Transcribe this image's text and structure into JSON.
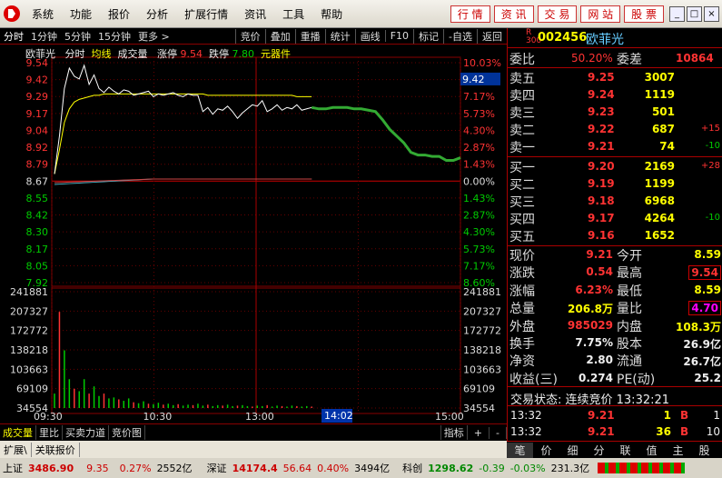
{
  "menu": {
    "items": [
      "系统",
      "功能",
      "报价",
      "分析",
      "扩展行情",
      "资讯",
      "工具",
      "帮助"
    ],
    "tools": [
      "行 情",
      "资 讯",
      "交 易",
      "网 站",
      "股 票"
    ],
    "win": [
      "_",
      "□",
      "×"
    ]
  },
  "tabs": {
    "items": [
      "分时",
      "1分钟",
      "5分钟",
      "15分钟",
      "更多 >"
    ],
    "buttons": [
      "竞价",
      "叠加",
      "重播",
      "统计",
      "画线",
      "F10",
      "标记",
      "-自选",
      "返回"
    ]
  },
  "chart_header": {
    "name": "欧菲光",
    "mode": "分时",
    "avg": "均线",
    "vol": "成交量",
    "zt_label": "涨停",
    "zt": "9.54",
    "dt_label": "跌停",
    "dt": "7.80",
    "sector": "元器件"
  },
  "chart_data": {
    "type": "line",
    "prev_close": 8.67,
    "price_ticks": [
      "9.54",
      "9.42",
      "9.29",
      "9.17",
      "9.04",
      "8.92",
      "8.79",
      "8.67",
      "8.55",
      "8.42",
      "8.30",
      "8.17",
      "8.05",
      "7.92"
    ],
    "pct_ticks": [
      "10.03%",
      "8.60%",
      "7.17%",
      "5.73%",
      "4.30%",
      "2.87%",
      "1.43%",
      "0.00%",
      "1.43%",
      "2.87%",
      "4.30%",
      "5.73%",
      "7.17%",
      "8.60%"
    ],
    "vol_ticks": [
      "241881",
      "207327",
      "172772",
      "138218",
      "103663",
      "69109",
      "34554"
    ],
    "time_ticks": [
      "09:30",
      "10:30",
      "13:00",
      "15:00"
    ],
    "cursor_time": "14:02",
    "cursor_price": "9.42",
    "price": [
      8.72,
      9.0,
      9.35,
      9.5,
      9.44,
      9.42,
      9.52,
      9.38,
      9.45,
      9.35,
      9.32,
      9.36,
      9.33,
      9.31,
      9.34,
      9.33,
      9.3,
      9.31,
      9.32,
      9.33,
      9.29,
      9.31,
      9.3,
      9.31,
      9.32,
      9.3,
      9.29,
      9.31,
      9.3,
      9.3,
      9.18,
      9.21,
      9.16,
      9.2,
      9.19,
      9.22,
      9.18,
      9.13,
      9.17,
      9.2,
      9.23,
      9.22,
      9.26,
      9.18,
      9.2,
      9.23,
      9.19,
      9.21,
      9.2,
      9.23,
      9.19,
      9.2,
      9.21
    ],
    "avg": [
      8.72,
      8.9,
      9.1,
      9.2,
      9.25,
      9.27,
      9.28,
      9.29,
      9.3,
      9.3,
      9.31,
      9.31,
      9.31,
      9.31,
      9.31,
      9.31,
      9.31,
      9.31,
      9.31,
      9.31,
      9.31,
      9.31,
      9.31,
      9.31,
      9.31,
      9.31,
      9.31,
      9.31,
      9.31,
      9.31,
      9.31,
      9.3,
      9.3,
      9.3,
      9.3,
      9.3,
      9.3,
      9.3,
      9.3,
      9.3,
      9.3,
      9.3,
      9.3,
      9.3,
      9.3,
      9.3,
      9.3,
      9.3,
      9.3,
      9.29,
      9.29,
      9.29,
      9.29
    ],
    "forecast": [
      9.21,
      9.2,
      9.2,
      9.21,
      9.21,
      9.21,
      9.2,
      9.2,
      9.19,
      9.18,
      9.12,
      9.05,
      9.0,
      8.95,
      8.88,
      8.86,
      8.86,
      8.85,
      8.85,
      8.82,
      8.82,
      8.84
    ],
    "volume": [
      30000,
      200000,
      120000,
      60000,
      40000,
      35000,
      60000,
      30000,
      45000,
      25000,
      30000,
      20000,
      22000,
      18000,
      15000,
      20000,
      12000,
      10000,
      14000,
      9000,
      8000,
      11000,
      7000,
      9000,
      6000,
      8000,
      5000,
      7000,
      6000,
      9000,
      5000,
      7000,
      4000,
      6000,
      5000,
      7000,
      4000,
      5000,
      6000,
      4000,
      3000,
      5000,
      4000,
      6000,
      3000,
      5000,
      4000,
      3000,
      5000,
      4000,
      3000,
      4000,
      3000
    ]
  },
  "quote": {
    "code": "002456",
    "name": "欧菲光",
    "ratio_label": "委比",
    "ratio": "50.20%",
    "diff_label": "委差",
    "diff": "10864",
    "asks": [
      {
        "l": "卖五",
        "p": "9.25",
        "v": "3007",
        "c": ""
      },
      {
        "l": "卖四",
        "p": "9.24",
        "v": "1119",
        "c": ""
      },
      {
        "l": "卖三",
        "p": "9.23",
        "v": "501",
        "c": ""
      },
      {
        "l": "卖二",
        "p": "9.22",
        "v": "687",
        "c": "+15"
      },
      {
        "l": "卖一",
        "p": "9.21",
        "v": "74",
        "c": "-10"
      }
    ],
    "bids": [
      {
        "l": "买一",
        "p": "9.20",
        "v": "2169",
        "c": "+28"
      },
      {
        "l": "买二",
        "p": "9.19",
        "v": "1199",
        "c": ""
      },
      {
        "l": "买三",
        "p": "9.18",
        "v": "6968",
        "c": ""
      },
      {
        "l": "买四",
        "p": "9.17",
        "v": "4264",
        "c": "-10"
      },
      {
        "l": "买五",
        "p": "9.16",
        "v": "1652",
        "c": ""
      }
    ],
    "stats": [
      [
        "现价",
        "9.21",
        "今开",
        "8.59"
      ],
      [
        "涨跌",
        "0.54",
        "最高",
        "9.54"
      ],
      [
        "涨幅",
        "6.23%",
        "最低",
        "8.59"
      ],
      [
        "总量",
        "206.8万",
        "量比",
        "4.70"
      ],
      [
        "外盘",
        "985029",
        "内盘",
        "108.3万"
      ],
      [
        "换手",
        "7.75%",
        "股本",
        "26.9亿"
      ],
      [
        "净资",
        "2.80",
        "流通",
        "26.7亿"
      ],
      [
        "收益(三)",
        "0.274",
        "PE(动)",
        "25.2"
      ]
    ],
    "trade_state": "交易状态: 连续竞价 13:32:21",
    "ticks": [
      {
        "t": "13:32",
        "p": "9.21",
        "v": "1",
        "s": "B",
        "n": "1"
      },
      {
        "t": "13:32",
        "p": "9.21",
        "v": "36",
        "s": "B",
        "n": "10"
      }
    ]
  },
  "bottom_tabs": [
    "成交量",
    "里比",
    "买卖力道",
    "竞价图"
  ],
  "bottom_right": [
    "指标",
    "+",
    "-"
  ],
  "sub_tabs": [
    "扩展\\",
    "关联报价"
  ],
  "right_tabs": [
    "笔",
    "价",
    "细",
    "分",
    "联",
    "值",
    "主",
    "股"
  ],
  "status": {
    "sh": "上证",
    "sh_v": "3486.90",
    "sh_c": "9.35",
    "sh_p": "0.27%",
    "sh_a": "2552亿",
    "sz": "深证",
    "sz_v": "14174.4",
    "sz_c": "56.64",
    "sz_p": "0.40%",
    "sz_a": "3494亿",
    "kc": "科创",
    "kc_v": "1298.62",
    "kc_c": "-0.39",
    "kc_p": "-0.03%",
    "kc_a": "231.3亿"
  }
}
